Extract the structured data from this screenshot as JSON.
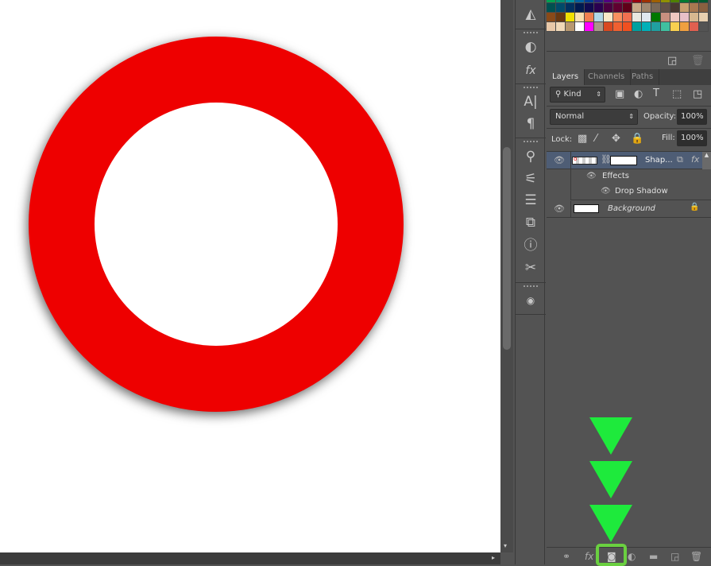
{
  "swatches": [
    "#00a050",
    "#009070",
    "#0090a0",
    "#0060a0",
    "#003c90",
    "#2a1f80",
    "#500080",
    "#800060",
    "#a0004a",
    "#9a0010",
    "#a03000",
    "#a06000",
    "#909000",
    "#508000",
    "#007a30",
    "#006020",
    "#005a30",
    "#005050",
    "#004a6a",
    "#003060",
    "#001a50",
    "#100a50",
    "#2a0050",
    "#4a0040",
    "#600030",
    "#600018",
    "#c8a888",
    "#a08870",
    "#786858",
    "#605048",
    "#483830",
    "#c8a070",
    "#a87850",
    "#886040",
    "#8a4a18",
    "#6a3810",
    "#f0e000",
    "#f8e0b0",
    "#f08050",
    "#b0d8e8",
    "#f8e8c8",
    "#f89060",
    "#f07050",
    "#e8e8e0",
    "#e0e8f0",
    "#007800",
    "#c89080",
    "#f0c8c0",
    "#e8c0c8",
    "#d8b890",
    "#e8d0b0",
    "#e8c8a8",
    "#f0d8b8",
    "#b89870",
    "#ffffff",
    "#ff00ff",
    "#a89888",
    "#d84820",
    "#f06030",
    "#f05020",
    "#00a0a0",
    "#00b0b8",
    "#20a0a0",
    "#40c0a0",
    "#f8d050",
    "#f0a040",
    "#e06050",
    "#535353"
  ],
  "tabs": [
    "Layers",
    "Channels",
    "Paths"
  ],
  "filter": {
    "label": "Kind"
  },
  "blend_mode": "Normal",
  "opacity": {
    "label": "Opacity:",
    "value": "100%"
  },
  "lock_label": "Lock:",
  "fill": {
    "label": "Fill:",
    "value": "100%"
  },
  "layers": [
    {
      "name": "Shap...",
      "effects_label": "Effects",
      "effect": "Drop Shadow"
    },
    {
      "name": "Background"
    }
  ],
  "colors": {
    "ring": "#ee0000",
    "arrow": "#1eea3c",
    "highlight": "#6ad040"
  },
  "tool_icons": [
    "histogram-icon",
    "adjustments-icon",
    "styles-icon",
    "character-icon",
    "paragraph-icon",
    "brush-presets-icon",
    "brush-icon",
    "clone-source-icon",
    "3d-icon",
    "info-icon",
    "tool-presets-icon",
    "gg-icon"
  ]
}
